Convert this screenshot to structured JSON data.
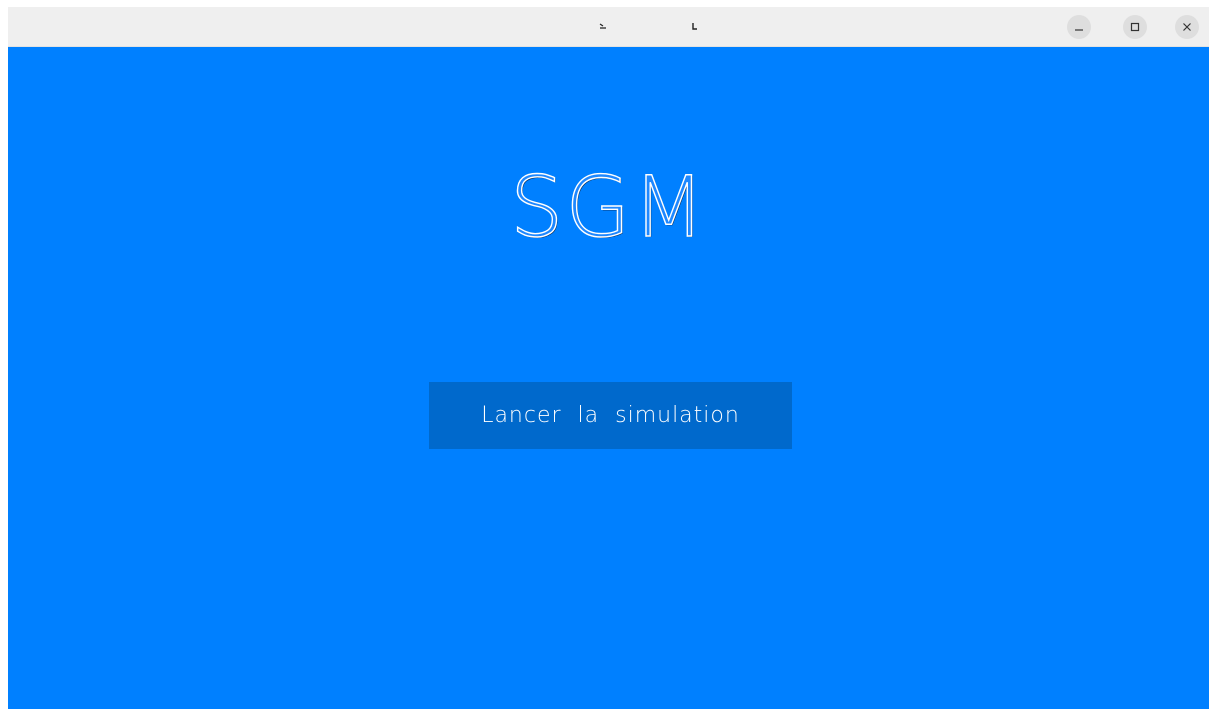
{
  "window": {
    "title_glyphs": [
      "left-glyph",
      "right-glyph"
    ],
    "controls": {
      "minimize_icon": "minimize-icon",
      "maximize_icon": "maximize-icon",
      "close_icon": "close-icon"
    },
    "background_color": "#0080ff",
    "titlebar_color": "#efefef"
  },
  "main": {
    "title": "SGM",
    "launch_button": {
      "label": "Lancer la simulation",
      "color": "#0069cc"
    }
  }
}
